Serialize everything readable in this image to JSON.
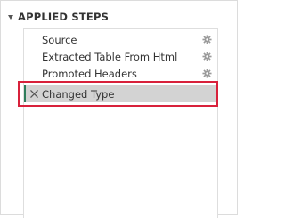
{
  "panel": {
    "title": "APPLIED STEPS"
  },
  "steps": [
    {
      "label": "Source",
      "icon": "gear-icon",
      "selected": false
    },
    {
      "label": "Extracted Table From Html",
      "icon": "gear-icon",
      "selected": false
    },
    {
      "label": "Promoted Headers",
      "icon": "gear-icon",
      "selected": false
    },
    {
      "label": "Changed Type",
      "icon": "delete-icon",
      "selected": true
    }
  ],
  "colors": {
    "selection_accent": "#2e7d5b",
    "highlight_outline": "#d8213b",
    "selected_row_bg": "#d3d3d3"
  }
}
